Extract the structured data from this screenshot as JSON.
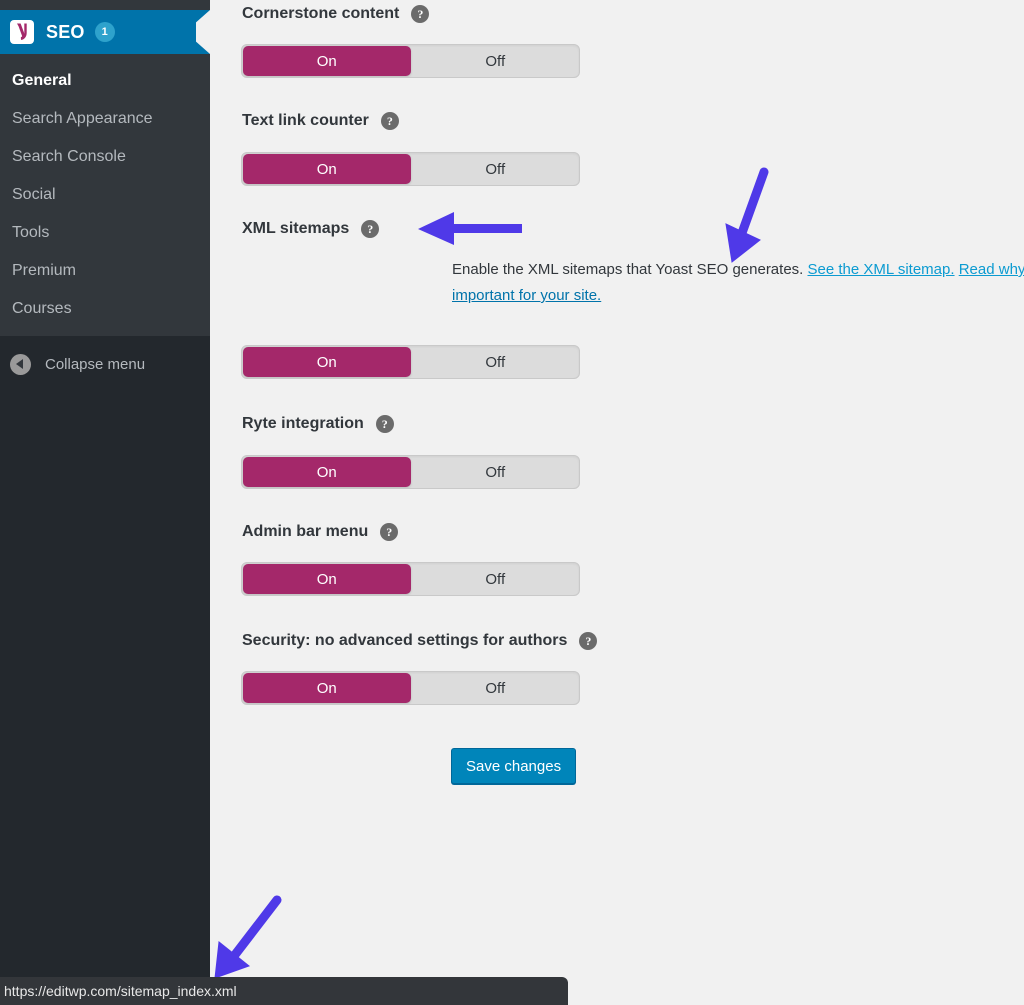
{
  "sidebar": {
    "brand": {
      "label": "SEO",
      "badge": "1",
      "logo_icon": "yoast-logo-icon",
      "color": "#0073aa"
    },
    "items": [
      {
        "label": "General",
        "active": true
      },
      {
        "label": "Search Appearance",
        "active": false
      },
      {
        "label": "Search Console",
        "active": false
      },
      {
        "label": "Social",
        "active": false
      },
      {
        "label": "Tools",
        "active": false
      },
      {
        "label": "Premium",
        "active": false
      },
      {
        "label": "Courses",
        "active": false
      }
    ],
    "collapse": {
      "label": "Collapse menu",
      "icon": "collapse-left-icon"
    }
  },
  "main": {
    "settings": [
      {
        "title": "Cornerstone content",
        "help_icon": "help-circle-icon",
        "value": "On",
        "on_label": "On",
        "off_label": "Off"
      },
      {
        "title": "Text link counter",
        "help_icon": "help-circle-icon",
        "value": "On",
        "on_label": "On",
        "off_label": "Off"
      },
      {
        "title": "XML sitemaps",
        "help_icon": "help-circle-icon",
        "value": "On",
        "on_label": "On",
        "off_label": "Off"
      },
      {
        "title": "Ryte integration",
        "help_icon": "help-circle-icon",
        "value": "On",
        "on_label": "On",
        "off_label": "Off"
      },
      {
        "title": "Admin bar menu",
        "help_icon": "help-circle-icon",
        "value": "On",
        "on_label": "On",
        "off_label": "Off"
      },
      {
        "title": "Security: no advanced settings for authors",
        "help_icon": "help-circle-icon",
        "value": "On",
        "on_label": "On",
        "off_label": "Off"
      }
    ],
    "sitemap_description": {
      "text": "Enable the XML sitemaps that Yoast SEO generates.",
      "link_sitemap": "See the XML sitemap.",
      "link_read_part1": "Read why XML",
      "link_read_part2": "Sitemaps are important for your site."
    },
    "save_label": "Save changes",
    "accent_magenta": "#a4286a",
    "accent_blue": "#0085ba",
    "link_color": "#0c9bd1"
  },
  "status_bar": {
    "url": "https://editwp.com/sitemap_index.xml"
  },
  "annotations": {
    "arrow_color": "#4f39e8",
    "arrows": [
      {
        "name": "arrow-pointing-xml-sitemaps-heading",
        "direction": "left"
      },
      {
        "name": "arrow-pointing-see-xml-sitemap-link",
        "direction": "down"
      },
      {
        "name": "arrow-pointing-status-bar-url",
        "direction": "down-left"
      }
    ]
  }
}
